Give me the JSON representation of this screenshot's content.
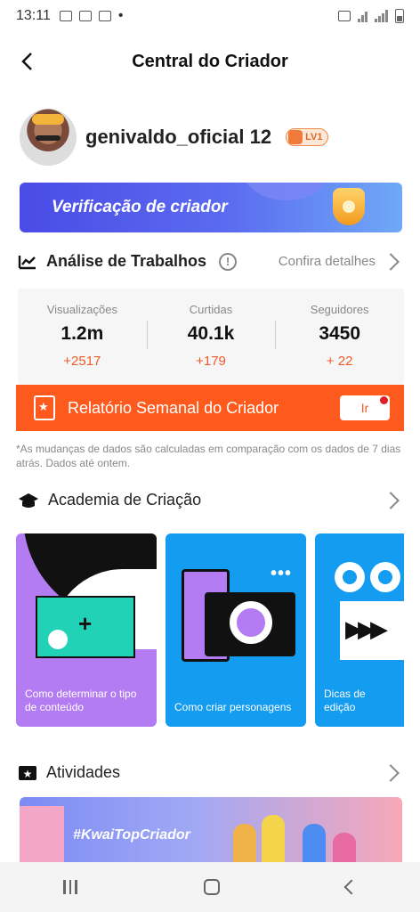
{
  "status_bar": {
    "time": "13:11"
  },
  "header": {
    "title": "Central do Criador"
  },
  "profile": {
    "username": "genivaldo_oficial 12",
    "level": "LV1"
  },
  "verify_banner": {
    "text": "Verificação de criador"
  },
  "analysis": {
    "title": "Análise de Trabalhos",
    "details_label": "Confira detalhes",
    "stats": [
      {
        "label": "Visualizações",
        "value": "1.2m",
        "delta": "+2517"
      },
      {
        "label": "Curtidas",
        "value": "40.1k",
        "delta": "+179"
      },
      {
        "label": "Seguidores",
        "value": "3450",
        "delta": "+ 22"
      }
    ]
  },
  "weekly_report": {
    "label": "Relatório Semanal do Criador",
    "button_label": "Ir"
  },
  "note": "*As mudanças de dados são calculadas em comparação com os dados de 7 dias atrás. Dados até ontem.",
  "academy": {
    "title": "Academia de Criação",
    "cards": [
      {
        "caption": "Como determinar o tipo de conteúdo"
      },
      {
        "caption": "Como criar personagens"
      },
      {
        "caption": "Dicas de edição"
      }
    ]
  },
  "activities": {
    "title": "Atividades",
    "banner_text": "#KwaiTopCriador"
  },
  "colors": {
    "accent": "#fe5a1d",
    "delta": "#f05a28",
    "banner": "#4a4be6"
  }
}
